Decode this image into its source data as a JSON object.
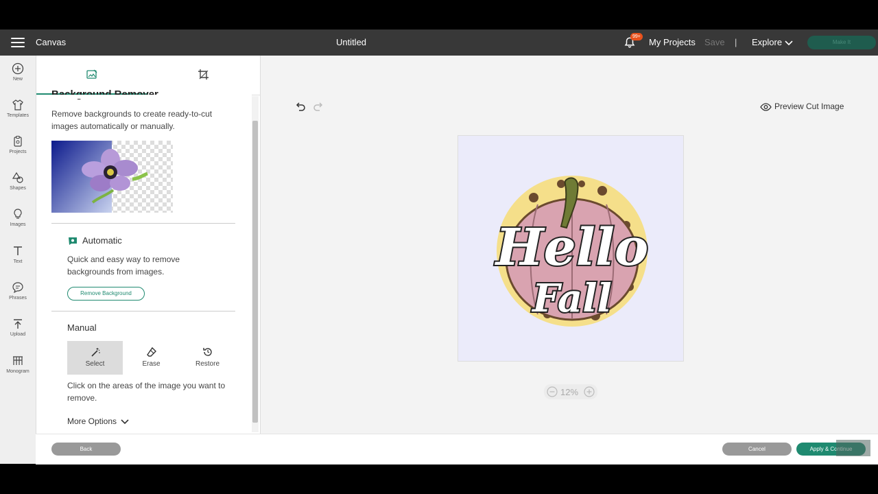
{
  "header": {
    "app_name": "Canvas",
    "doc_title": "Untitled",
    "notification_badge": "99+",
    "my_projects": "My Projects",
    "save": "Save",
    "divider": "|",
    "explore": "Explore",
    "make_it": "Make It"
  },
  "sidebar": {
    "items": [
      {
        "label": "New",
        "icon": "plus-circle-icon"
      },
      {
        "label": "Templates",
        "icon": "shirt-icon"
      },
      {
        "label": "Projects",
        "icon": "clipboard-icon"
      },
      {
        "label": "Shapes",
        "icon": "shapes-icon"
      },
      {
        "label": "Images",
        "icon": "lightbulb-icon"
      },
      {
        "label": "Text",
        "icon": "text-icon"
      },
      {
        "label": "Phrases",
        "icon": "speech-bubble-icon"
      },
      {
        "label": "Upload",
        "icon": "upload-icon"
      },
      {
        "label": "Monogram",
        "icon": "monogram-icon"
      }
    ]
  },
  "panel": {
    "heading": "Background Remover",
    "description": "Remove backgrounds to create ready-to-cut images automatically or manually.",
    "automatic": {
      "title": "Automatic",
      "description": "Quick and easy way to remove backgrounds from images.",
      "button": "Remove Background"
    },
    "manual": {
      "title": "Manual",
      "tools": [
        {
          "label": "Select",
          "icon": "magic-wand-icon",
          "active": true
        },
        {
          "label": "Erase",
          "icon": "eraser-icon",
          "active": false
        },
        {
          "label": "Restore",
          "icon": "restore-icon",
          "active": false
        }
      ],
      "description": "Click on the areas of the image you want to remove.",
      "more_options": "More Options"
    }
  },
  "canvas": {
    "preview_label": "Preview Cut Image",
    "zoom": "12%",
    "artwork_line1": "Hello",
    "artwork_line2": "Fall"
  },
  "footer": {
    "back": "Back",
    "cancel": "Cancel",
    "apply": "Apply & Continue"
  },
  "colors": {
    "accent": "#1f8a70",
    "topbar": "#383838",
    "badge": "#e8511c"
  }
}
